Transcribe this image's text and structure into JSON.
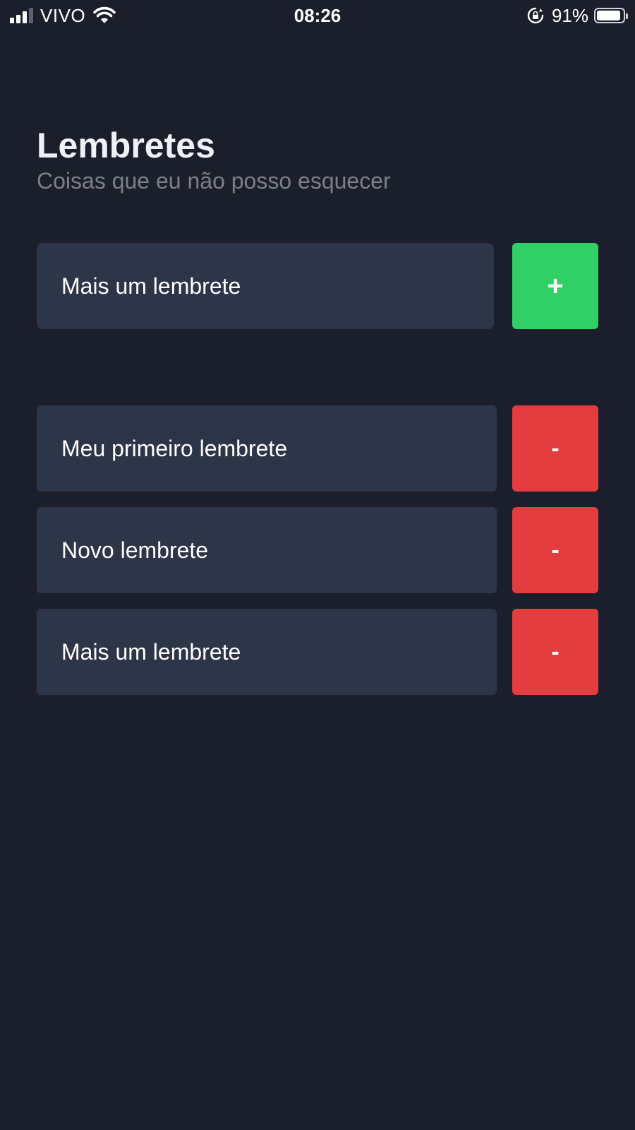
{
  "status_bar": {
    "carrier": "VIVO",
    "time": "08:26",
    "battery_percent": "91%",
    "battery_level": 0.91,
    "icons": [
      "signal-icon",
      "wifi-icon",
      "rotation-lock-icon",
      "battery-icon"
    ]
  },
  "header": {
    "title": "Lembretes",
    "subtitle": "Coisas que eu não posso esquecer"
  },
  "new_reminder": {
    "input_value": "Mais um lembrete",
    "add_label": "+"
  },
  "reminders": [
    {
      "text": "Meu primeiro lembrete",
      "remove_label": "-"
    },
    {
      "text": "Novo lembrete",
      "remove_label": "-"
    },
    {
      "text": "Mais um lembrete",
      "remove_label": "-"
    }
  ],
  "colors": {
    "background": "#1b1f2b",
    "card": "#2d3548",
    "add_button": "#30d067",
    "remove_button": "#e43d40",
    "subtitle": "#7b7f8a"
  }
}
